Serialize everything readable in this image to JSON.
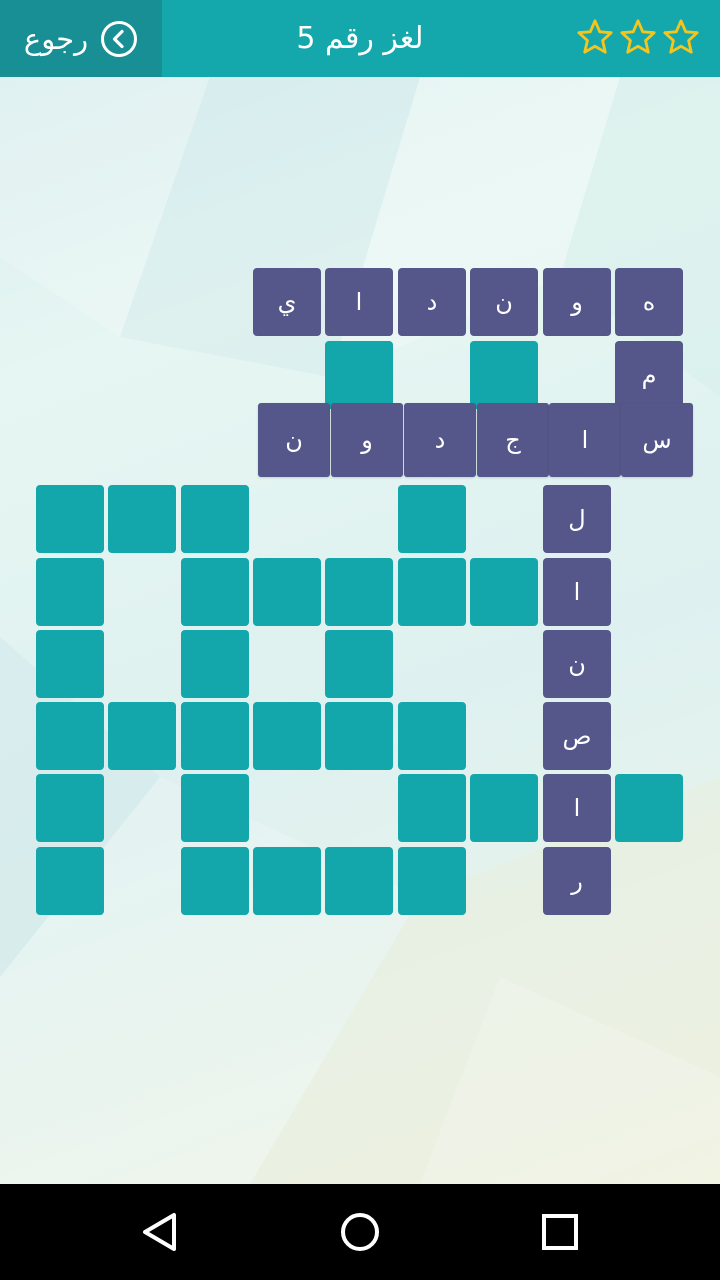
{
  "header": {
    "back_label": "رجوع",
    "title": "لغز رقم 5",
    "stars_earned": 0,
    "stars_total": 3,
    "star_color": "#f4c51d"
  },
  "colors": {
    "header_bg": "#14a7ab",
    "back_bg": "#178f95",
    "empty_cell": "#13a6aa",
    "filled_cell": "#555689"
  },
  "words": {
    "row1": [
      "ي",
      "ا",
      "د",
      "ن",
      "و",
      "ه"
    ],
    "row3": [
      "ن",
      "و",
      "د",
      "ج",
      "ا",
      "س"
    ],
    "column": [
      "م",
      "ل",
      "ا",
      "ن",
      "ص",
      "ا",
      "ر"
    ]
  },
  "icons": {
    "back": "chevron-left-circle-icon",
    "star": "star-outline-icon",
    "nav_back": "triangle-back-icon",
    "nav_home": "circle-home-icon",
    "nav_recents": "square-recents-icon"
  }
}
